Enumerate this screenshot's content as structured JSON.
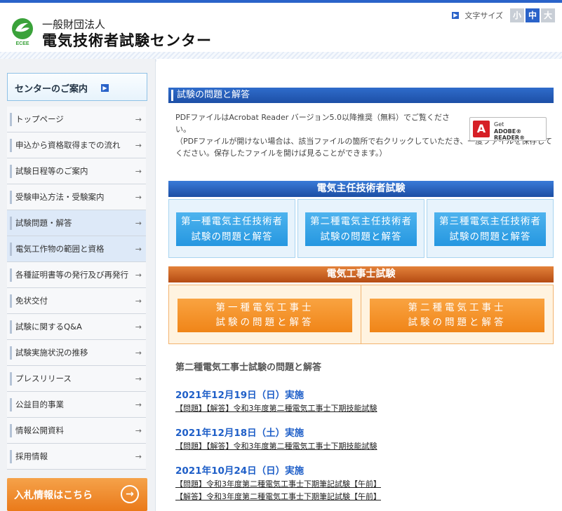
{
  "header": {
    "logo_text": "ECEE",
    "org_type": "一般財団法人",
    "org_name": "電気技術者試験センター",
    "font_size_label": "文字サイズ",
    "font_sizes": [
      "小",
      "中",
      "大"
    ]
  },
  "sidebar": {
    "center_guide": "センターのご案内",
    "items": [
      {
        "label": "トップページ"
      },
      {
        "label": "申込から資格取得までの流れ"
      },
      {
        "label": "試験日程等のご案内"
      },
      {
        "label": "受験申込方法・受験案内"
      },
      {
        "label": "試験問題・解答"
      },
      {
        "label": "電気工作物の範囲と資格"
      },
      {
        "label": "各種証明書等の発行及び再発行"
      },
      {
        "label": "免状交付"
      },
      {
        "label": "試験に関するQ&A"
      },
      {
        "label": "試験実施状況の推移"
      },
      {
        "label": "プレスリリース"
      },
      {
        "label": "公益目的事業"
      },
      {
        "label": "情報公開資料"
      },
      {
        "label": "採用情報"
      }
    ],
    "bid_banner": "入札情報はこちら"
  },
  "main": {
    "section_title": "試験の問題と解答",
    "pdf_note": "PDFファイルはAcrobat Reader バージョン5.0以降推奨（無料）でご覧ください。",
    "pdf_note2": "（PDFファイルが開けない場合は、該当ファイルの箇所で右クリックしていただき、一度ファイルを保存してください。保存したファイルを開けば見ることができます。）",
    "adobe_get": "Get",
    "adobe_reader": "ADOBE® READER®",
    "chief_band": "電気主任技術者試験",
    "chief_buttons": [
      {
        "line1": "第一種電気主任技術者",
        "line2": "試験の問題と解答"
      },
      {
        "line1": "第二種電気主任技術者",
        "line2": "試験の問題と解答"
      },
      {
        "line1": "第三種電気主任技術者",
        "line2": "試験の問題と解答"
      }
    ],
    "worker_band": "電気工事士試験",
    "worker_buttons": [
      {
        "line1": "第一種電気工事士",
        "line2": "試験の問題と解答"
      },
      {
        "line1": "第二種電気工事士",
        "line2": "試験の問題と解答"
      }
    ],
    "exam_title": "第二種電気工事士試験の問題と解答",
    "dates": [
      {
        "date": "2021年12月19日（日）実施",
        "links": [
          "【問題】【解答】令和3年度第二種電気工事士下期技能試験"
        ]
      },
      {
        "date": "2021年12月18日（土）実施",
        "links": [
          "【問題】【解答】令和3年度第二種電気工事士下期技能試験"
        ]
      },
      {
        "date": "2021年10月24日（日）実施",
        "links": [
          "【問題】令和3年度第二種電気工事士下期筆記試験【午前】",
          "【解答】令和3年度第二種電気工事士下期筆記試験【午前】"
        ]
      }
    ]
  }
}
